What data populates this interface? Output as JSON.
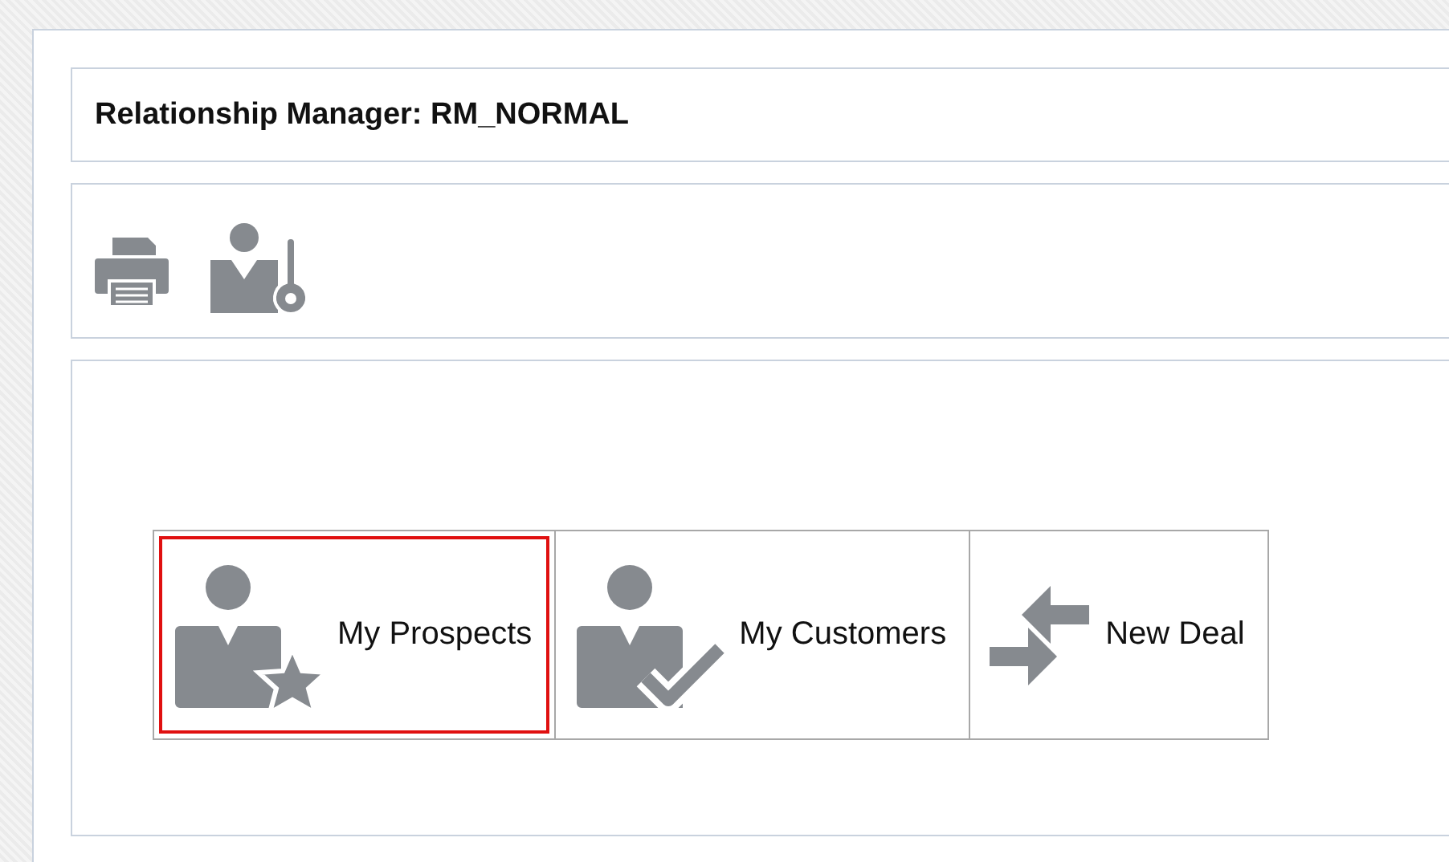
{
  "header": {
    "title": "Relationship Manager: RM_NORMAL"
  },
  "toolbar": [
    {
      "kind": "print"
    },
    {
      "kind": "user-key"
    }
  ],
  "tiles": [
    {
      "kind": "prospects",
      "label": "My Prospects",
      "selected": true
    },
    {
      "kind": "customers",
      "label": "My Customers",
      "selected": false
    },
    {
      "kind": "deal",
      "label": "New Deal",
      "selected": false
    }
  ]
}
